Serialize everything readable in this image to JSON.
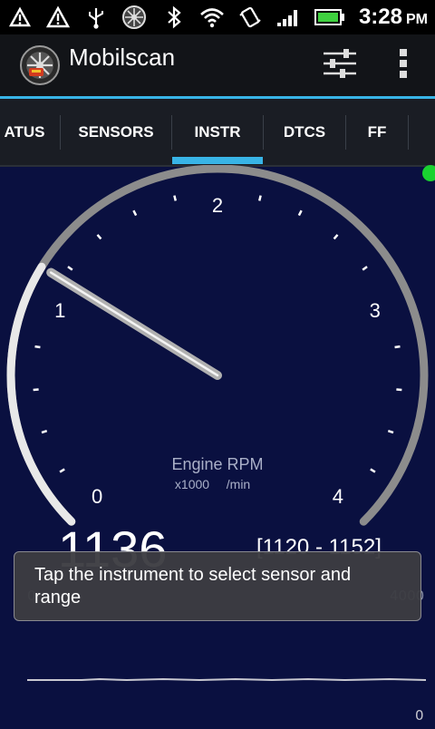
{
  "status_bar": {
    "time": "3:28",
    "ampm": "PM",
    "left_icons": [
      "usb-debug-icon",
      "warning-icon",
      "usb-icon",
      "mobilscan-wheel-icon"
    ],
    "right_icons": [
      "bluetooth-icon",
      "wifi-icon",
      "vibrate-icon",
      "signal-icon",
      "battery-icon"
    ],
    "battery_color": "#3fd13f"
  },
  "app_bar": {
    "title": "Mobilscan",
    "actions": [
      "settings-sliders-icon",
      "overflow-menu-icon"
    ]
  },
  "tabs": {
    "items": [
      {
        "label": "ATUS"
      },
      {
        "label": "SENSORS"
      },
      {
        "label": "INSTR"
      },
      {
        "label": "DTCS"
      },
      {
        "label": "FF"
      }
    ],
    "active": "INSTR",
    "accent": "#38b4e6"
  },
  "gauge": {
    "title": "Engine RPM",
    "unit": "x1000",
    "per": "/min",
    "scale_labels": [
      "0",
      "1",
      "2",
      "3",
      "4"
    ],
    "min": 0,
    "max": 4,
    "value_x1000": 1.136
  },
  "readout": {
    "value": "1136",
    "range": "[1120 - 1152]",
    "min": "0",
    "max": "4000",
    "trace_min": "0"
  },
  "toast": {
    "message": "Tap the instrument to select sensor and range"
  },
  "colors": {
    "background": "#0a1040",
    "gauge_arc": "#8c8c8c",
    "gauge_progress": "#e8e8e8",
    "status_dot": "#19d230"
  }
}
